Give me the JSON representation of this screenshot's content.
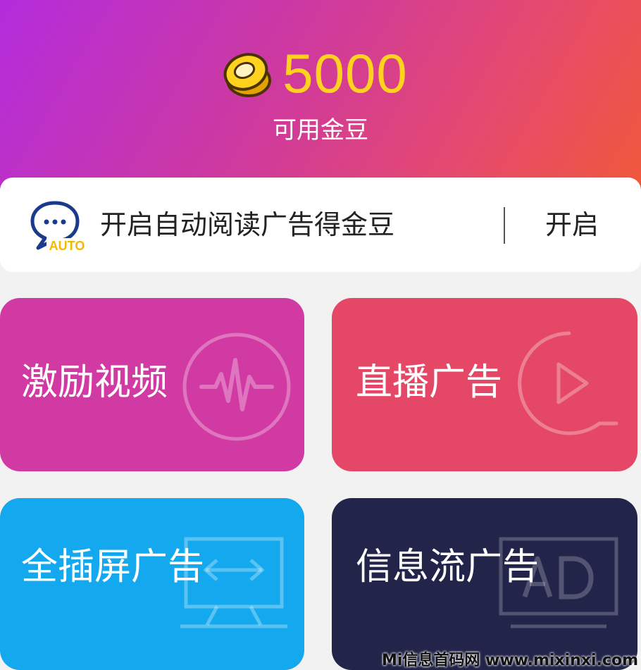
{
  "balance": {
    "value": "5000",
    "label": "可用金豆",
    "icon": "gold-coin-icon"
  },
  "auto_read": {
    "icon": "auto-chat-icon",
    "icon_badge": "AUTO",
    "text": "开启自动阅读广告得金豆",
    "button_label": "开启"
  },
  "tiles": [
    {
      "label": "激励视频",
      "icon": "waveform-icon",
      "color": "#d23aa3"
    },
    {
      "label": "直播广告",
      "icon": "play-icon",
      "color": "#e54866"
    },
    {
      "label": "全插屏广告",
      "icon": "monitor-icon",
      "color": "#14a9ef"
    },
    {
      "label": "信息流广告",
      "icon": "ad-screen-icon",
      "color": "#22244a"
    }
  ],
  "colors": {
    "header_start": "#b32cdc",
    "header_end": "#f0583a",
    "balance": "#ffd21f",
    "auto_icon": "#1a3a8c",
    "auto_badge": "#f5b800"
  },
  "watermark": "Mi信息首码网 www.mixinxi.com"
}
